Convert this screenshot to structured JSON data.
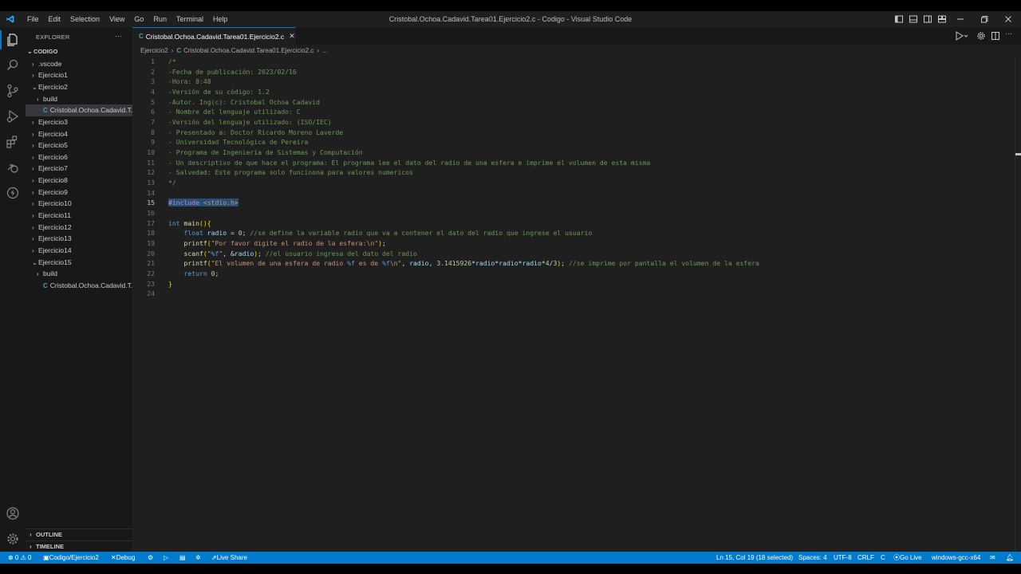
{
  "window": {
    "title": "Cristobal.Ochoa.Cadavid.Tarea01.Ejercicio2.c - Codigo - Visual Studio Code",
    "menu": [
      "File",
      "Edit",
      "Selection",
      "View",
      "Go",
      "Run",
      "Terminal",
      "Help"
    ]
  },
  "sidebar": {
    "title": "EXPLORER",
    "root": "CODIGO",
    "items": [
      {
        "label": ".vscode",
        "chev": "›"
      },
      {
        "label": "Ejercicio1",
        "chev": "›"
      },
      {
        "label": "Ejercicio2",
        "chev": "⌄"
      },
      {
        "label": "build",
        "chev": "›"
      },
      {
        "label": "Cristobal.Ochoa.Cadavid.T...",
        "chev": ""
      },
      {
        "label": "Ejercicio3",
        "chev": "›"
      },
      {
        "label": "Ejercicio4",
        "chev": "›"
      },
      {
        "label": "Ejercicio5",
        "chev": "›"
      },
      {
        "label": "Ejercicio6",
        "chev": "›"
      },
      {
        "label": "Ejercicio7",
        "chev": "›"
      },
      {
        "label": "Ejercicio8",
        "chev": "›"
      },
      {
        "label": "Ejercicio9",
        "chev": "›"
      },
      {
        "label": "Ejercicio10",
        "chev": "›"
      },
      {
        "label": "Ejercicio11",
        "chev": "›"
      },
      {
        "label": "Ejercicio12",
        "chev": "›"
      },
      {
        "label": "Ejercicio13",
        "chev": "›"
      },
      {
        "label": "Ejercicio14",
        "chev": "›"
      },
      {
        "label": "Ejercicio15",
        "chev": "⌄"
      },
      {
        "label": "build",
        "chev": "›"
      },
      {
        "label": "Cristobal.Ochoa.Cadavid.T...",
        "chev": ""
      }
    ],
    "outline": "OUTLINE",
    "timeline": "TIMELINE"
  },
  "editor": {
    "tab_label": "Cristobal.Ochoa.Cadavid.Tarea01.Ejercicio2.c",
    "breadcrumb": [
      "Ejercicio2",
      "Cristobal.Ochoa.Cadavid.Tarea01.Ejercicio2.c",
      "..."
    ],
    "current_line": 15,
    "lines": [
      "/*",
      "-Fecha de publicación: 2023/02/16",
      "-Hora: 8:48",
      "-Versión de su código: 1.2",
      "-Autor. Ing(c): Cristobal Ochoa Cadavid",
      "- Nombre del lenguaje utilizado: C",
      "-Versión del lenguaje utilizado: (ISO/IEC)",
      "- Presentado a: Doctor Ricardo Moreno Laverde",
      "- Universidad Tecnológica de Pereira",
      "- Programa de Ingeniería de Sistemas y Computación",
      "- Un descriptivo de que hace el programa: El programa lee el dato del radio de una esfera e imprime el volumen de esta misma",
      "- Salvedad: Este programa solo funcinona para valores numericos",
      "*/",
      "",
      "#include <stdio.h>",
      "",
      "int main(){",
      "    float radio = 0; //se define la variable radio que va a contener el dato del radio que ingrese el usuario",
      "    printf(\"Por favor digite el radio de la esfera:\\n\");",
      "    scanf(\"%f\", &radio); //el usuario ingresa del dato del radio",
      "    printf(\"El volumen de una esfera de radio %f es de %f\\n\", radio, 3.1415926*radio*radio*radio*4/3); //se imprime por pantalla el volumen de la esfera",
      "    return 0;",
      "}",
      ""
    ]
  },
  "statusbar": {
    "errors": "⊗ 0 ⚠ 0",
    "folder": "Codigo/Ejercicio2",
    "debug": "Debug",
    "live_share": "Live Share",
    "position": "Ln 15, Col 19 (18 selected)",
    "spaces": "Spaces: 4",
    "encoding": "UTF-8",
    "eol": "CRLF",
    "language": "C",
    "go_live": "Go Live",
    "compiler": "windows-gcc-x64"
  },
  "colors": {
    "accent": "#007acc",
    "comment": "#6a9955",
    "keyword": "#569cd6",
    "function": "#dcdcaa",
    "string": "#ce9178"
  }
}
